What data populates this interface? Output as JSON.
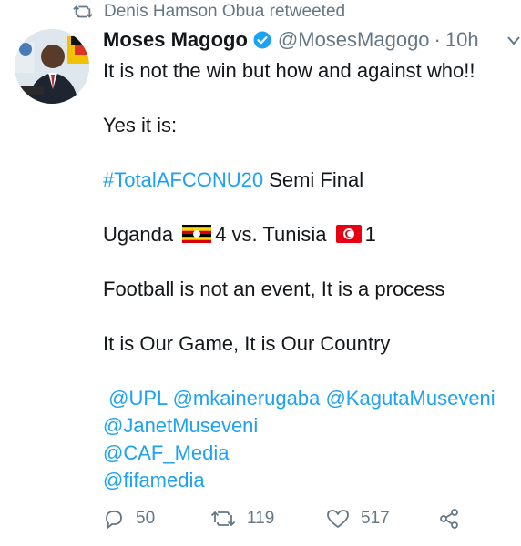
{
  "retweet_banner": {
    "text": "Denis Hamson Obua retweeted"
  },
  "tweet": {
    "author_name": "Moses Magogo",
    "handle": "@MosesMagogo",
    "separator": "·",
    "time": "10h",
    "lines": {
      "l1": "It is not the win but how and against who!!",
      "l2": "Yes it is:",
      "hashtag": "#TotalAFCONU20",
      "l3_rest": " Semi Final",
      "team1": "Uganda",
      "score1": "4 vs. Tunisia",
      "score2": "1",
      "l5": "Football is not an event, It is a process",
      "l6": "It is Our Game, It is Our Country",
      "m1": "@UPL",
      "m2": "@mkainerugaba",
      "m3": "@KagutaMuseveni",
      "m4": "@JanetMuseveni",
      "m5": "@CAF_Media",
      "m6": "@fifamedia"
    }
  },
  "actions": {
    "replies": "50",
    "retweets": "119",
    "likes": "517"
  },
  "colors": {
    "link": "#1da1f2",
    "muted": "#657786",
    "text": "#14171a"
  }
}
